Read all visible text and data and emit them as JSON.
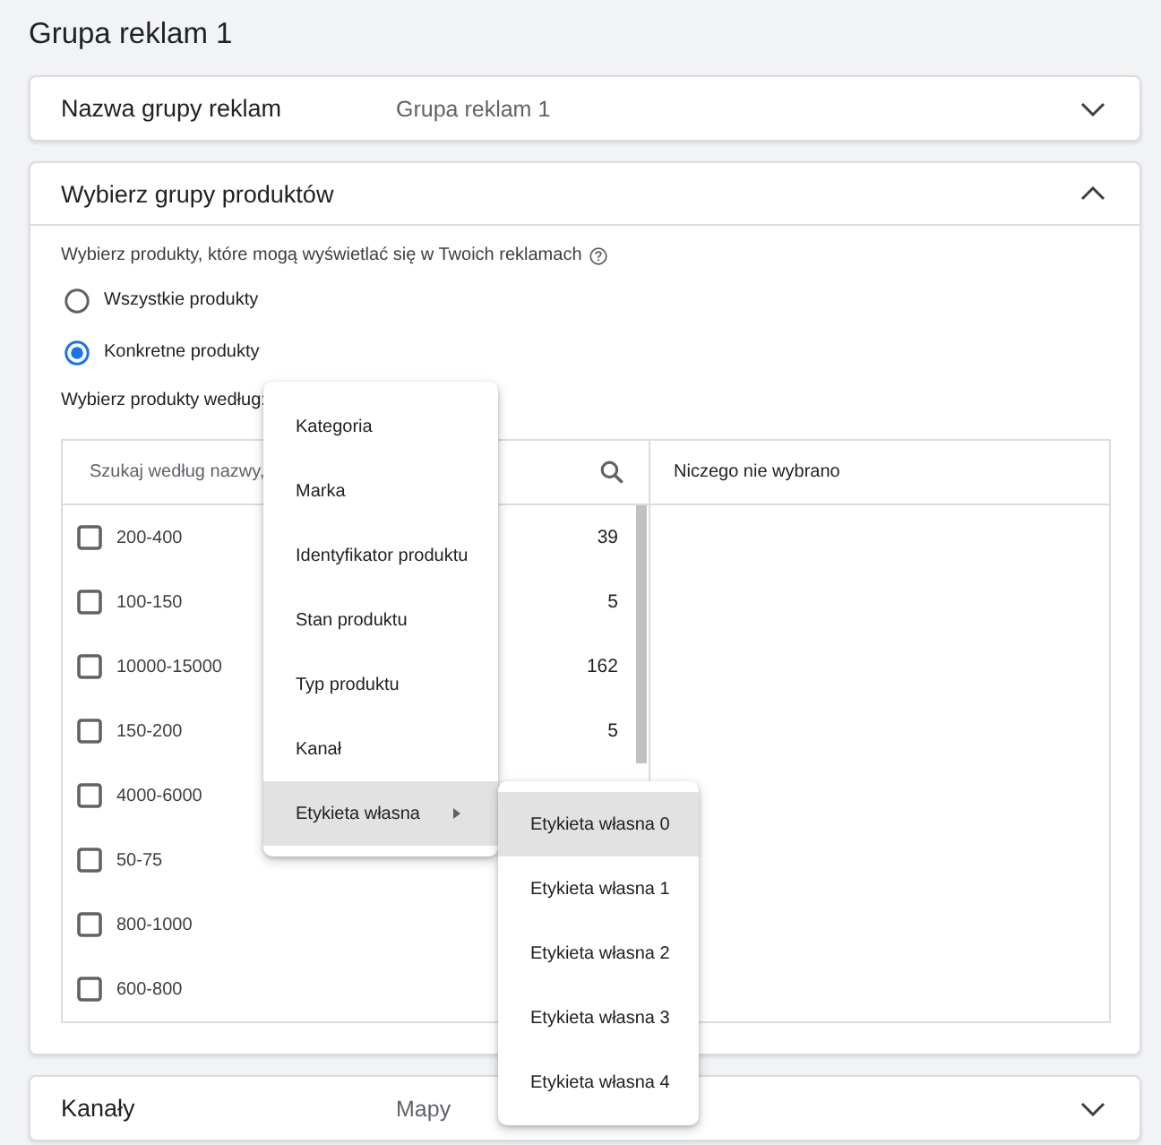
{
  "page_title": "Grupa reklam 1",
  "sections": [
    {
      "kind": "summary",
      "title": "Nazwa grupy reklam",
      "value": "Grupa reklam 1",
      "expanded": false
    },
    {
      "kind": "product_groups",
      "title": "Wybierz grupy produktów",
      "expanded": true,
      "description": "Wybierz produkty, które mogą wyświetlać się w Twoich reklamach",
      "radio_options": [
        {
          "label": "Wszystkie produkty",
          "selected": false
        },
        {
          "label": "Konkretne produkty",
          "selected": true
        }
      ],
      "select_by_label": "Wybierz produkty według:",
      "search": {
        "placeholder": "Szukaj według nazwy,"
      },
      "items": [
        {
          "label": "200-400",
          "count": "39",
          "checked": false
        },
        {
          "label": "100-150",
          "count": "5",
          "checked": false
        },
        {
          "label": "10000-15000",
          "count": "162",
          "checked": false
        },
        {
          "label": "150-200",
          "count": "5",
          "checked": false
        },
        {
          "label": "4000-6000",
          "checked": false
        },
        {
          "label": "50-75",
          "checked": false
        },
        {
          "label": "800-1000",
          "checked": false
        },
        {
          "label": "600-800",
          "checked": false
        }
      ],
      "selected_panel": {
        "empty_text": "Niczego nie wybrano"
      }
    },
    {
      "kind": "summary",
      "title": "Kanały",
      "value": "Mapy",
      "expanded": false
    }
  ],
  "menu": {
    "items": [
      {
        "label": "Kategoria",
        "kind": "option",
        "selected": false
      },
      {
        "label": "Marka",
        "kind": "option",
        "selected": false
      },
      {
        "label": "Identyfikator produktu",
        "kind": "option",
        "selected": false
      },
      {
        "label": "Stan produktu",
        "kind": "option",
        "selected": false
      },
      {
        "label": "Typ produktu",
        "kind": "option",
        "selected": false
      },
      {
        "label": "Kanał",
        "kind": "option",
        "selected": false
      },
      {
        "label": "Etykieta własna",
        "kind": "submenu",
        "selected": true
      }
    ]
  },
  "submenu": {
    "items": [
      {
        "label": "Etykieta własna 0",
        "selected": true
      },
      {
        "label": "Etykieta własna 1",
        "selected": false
      },
      {
        "label": "Etykieta własna 2",
        "selected": false
      },
      {
        "label": "Etykieta własna 3",
        "selected": false
      },
      {
        "label": "Etykieta własna 4",
        "selected": false
      }
    ]
  }
}
